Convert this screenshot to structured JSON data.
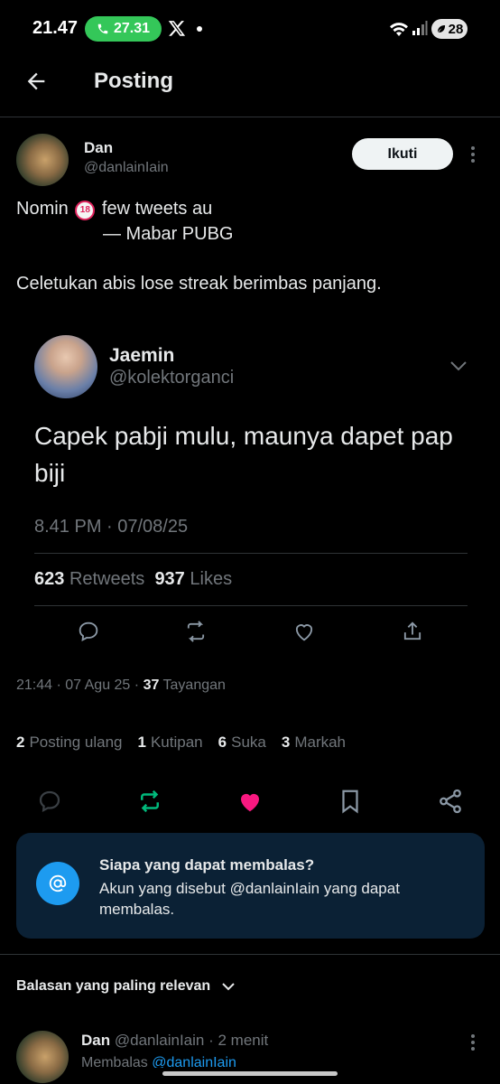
{
  "status_bar": {
    "time": "21.47",
    "call_time": "27.31",
    "battery": "28"
  },
  "header": {
    "title": "Posting"
  },
  "post": {
    "author_name": "Dan",
    "author_handle": "@danlainIain",
    "follow_label": "Ikuti",
    "text_line1_a": "Nomin",
    "badge": "18",
    "text_line1_b": "few tweets au",
    "text_line2": "— Mabar PUBG",
    "text_line3": "Celetukan abis lose streak berimbas panjang.",
    "timestamp": "21:44 · 07 Agu 25 ·",
    "views_count": "37",
    "views_label": "Tayangan",
    "stats": [
      {
        "count": "2",
        "label": "Posting ulang"
      },
      {
        "count": "1",
        "label": "Kutipan"
      },
      {
        "count": "6",
        "label": "Suka"
      },
      {
        "count": "3",
        "label": "Markah"
      }
    ]
  },
  "embedded": {
    "name": "Jaemin",
    "handle": "@kolektorganci",
    "text": "Capek pabji mulu, maunya dapet pap biji",
    "time": "8.41 PM · 07/08/25",
    "retweets_count": "623",
    "retweets_label": "Retweets",
    "likes_count": "937",
    "likes_label": "Likes"
  },
  "reply_info": {
    "title": "Siapa yang dapat membalas?",
    "body": "Akun yang disebut @danlainIain yang dapat membalas."
  },
  "sort_label": "Balasan yang paling relevan",
  "reply": {
    "name": "Dan",
    "handle": "@danlainIain",
    "time": "· 2 menit",
    "replying_to_label": "Membalas",
    "replying_to_handle": "@danlainIain"
  },
  "colors": {
    "accent": "#1d9bf0",
    "like": "#f91880",
    "repost": "#00ba7c",
    "info_bg": "#0b2135"
  }
}
